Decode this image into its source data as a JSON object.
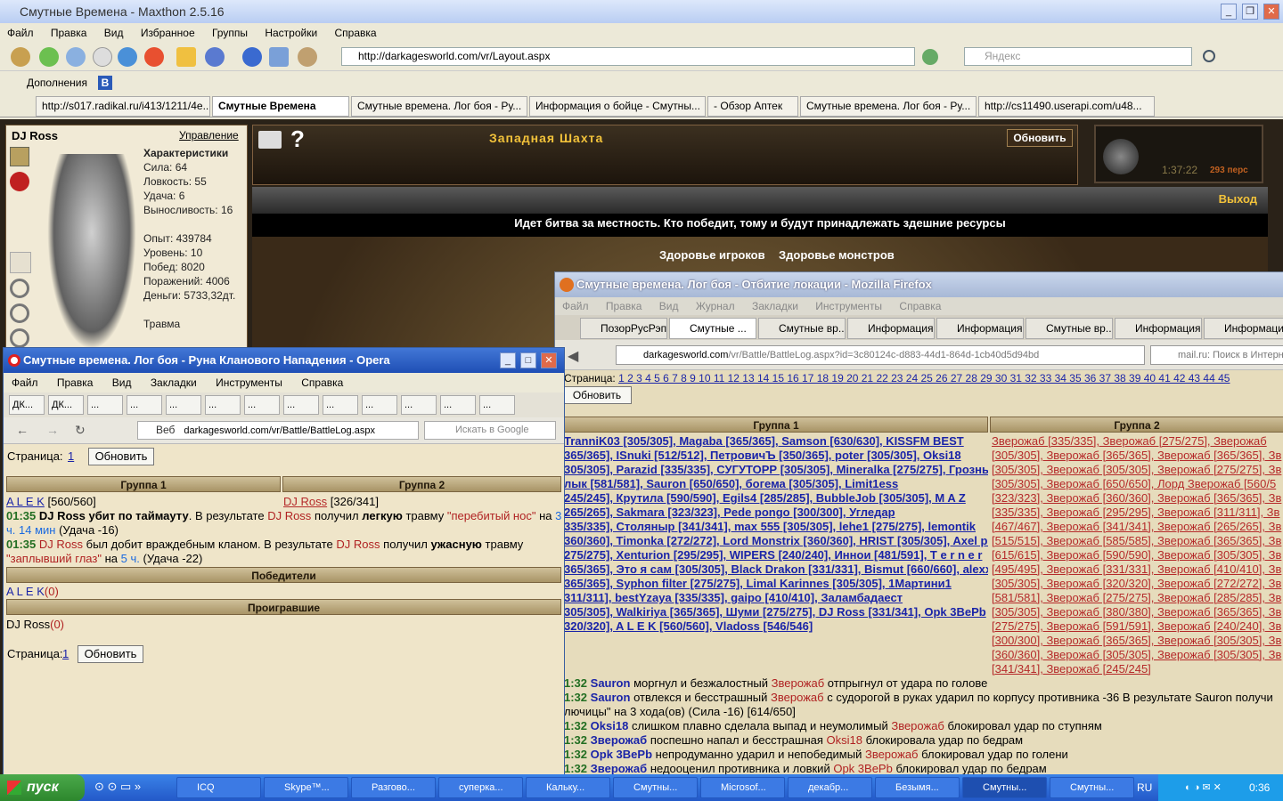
{
  "maxthon": {
    "title": "Смутные Времена - Maxthon 2.5.16",
    "menu": [
      "Файл",
      "Правка",
      "Вид",
      "Избранное",
      "Группы",
      "Настройки",
      "Справка"
    ],
    "url": "http://darkagesworld.com/vr/Layout.aspx",
    "search_placeholder": "Яндекс",
    "addons_label": "Дополнения",
    "tabs": [
      "http://s017.radikal.ru/i413/1211/4e...",
      "Смутные Времена",
      "Смутные времена. Лог боя - Ру...",
      "Информация о бойце - Смутны...",
      "- Обзор Аптек",
      "Смутные времена. Лог боя - Ру...",
      "http://cs11490.userapi.com/u48..."
    ]
  },
  "game": {
    "player": "DJ Ross",
    "manage": "Управление",
    "chars_title": "Характеристики",
    "stats": [
      "Сила: 64",
      "Ловкость: 55",
      "Удача: 6",
      "Выносливость: 16"
    ],
    "exp": [
      "Опыт: 439784",
      "Уровень: 10",
      "Побед: 8020",
      "Поражений: 4006",
      "Деньги: 5733,32дт."
    ],
    "injury": "Травма",
    "location": "Западная Шахта",
    "refresh": "Обновить",
    "exit": "Выход",
    "time": "1:37:22",
    "players_count": "293 перс",
    "battle_text": "Идет битва за местность. Кто победит, тому и будут принадлежать здешние ресурсы",
    "health_players": "Здоровье игроков",
    "health_monsters": "Здоровье монстров"
  },
  "opera": {
    "title": "Смутные времена. Лог боя - Руна Кланового Нападения - Opera",
    "menu": [
      "Файл",
      "Правка",
      "Вид",
      "Закладки",
      "Инструменты",
      "Справка"
    ],
    "tabs": [
      "ДК...",
      "ДК...",
      "...",
      "...",
      "...",
      "...",
      "...",
      "...",
      "...",
      "...",
      "...",
      "...",
      "..."
    ],
    "web": "Веб",
    "url": "darkagesworld.com/vr/Battle/BattleLog.aspx",
    "search": "Искать в Google",
    "page_label": "Страница:",
    "page_num": "1",
    "refresh": "Обновить",
    "group1": "Группа 1",
    "group2": "Группа 2",
    "g1_player": "A L E K",
    "g1_hp": "[560/560]",
    "g2_player": "DJ Ross",
    "g2_hp": "[326/341]",
    "log1_time": "01:35",
    "log1_a": "DJ Ross убит по таймауту",
    "log1_b": ". В результате",
    "log1_name": "DJ Ross",
    "log1_c": "получил",
    "log1_d": "легкую",
    "log1_e": "травму",
    "log1_injury": "\"перебитый нос\"",
    "log1_f": "на",
    "log1_dur": "3 ч. 14 мин",
    "log1_g": "(Удача -16)",
    "log2_time": "01:35",
    "log2_name": "DJ Ross",
    "log2_a": "был добит враждебным кланом. В результате",
    "log2_name2": "DJ Ross",
    "log2_b": "получил",
    "log2_c": "ужасную",
    "log2_d": "травму",
    "log2_injury": "\"заплывший глаз\"",
    "log2_e": "на",
    "log2_dur": "5 ч.",
    "log2_f": "(Удача -22)",
    "winners": "Победители",
    "winner": "A L E K",
    "winner_score": "(0)",
    "losers": "Проигравшие",
    "loser": "DJ Ross",
    "loser_score": "(0)"
  },
  "firefox": {
    "title": "Смутные времена. Лог боя - Отбитие локации - Mozilla Firefox",
    "menu": [
      "Файл",
      "Правка",
      "Вид",
      "Журнал",
      "Закладки",
      "Инструменты",
      "Справка"
    ],
    "tabs": [
      "ПозорРусРэпа",
      "Смутные ...",
      "Смутные вр...",
      "Информация...",
      "Информация...",
      "Смутные вр...",
      "Информация...",
      "Информация..."
    ],
    "url_host": "darkagesworld.com",
    "url_path": "/vr/Battle/BattleLog.aspx?id=3c80124c-d883-44d1-864d-1cb40d5d94bd",
    "search": "mail.ru: Поиск в Интерн",
    "page_label": "Страница:",
    "pages": "1 2 3 4 5 6 7 8 9 10 11 12 13 14 15 16 17 18 19 20 21 22 23 24 25 26 27 28 29 30 31 32 33 34 35 36 37 38 39 40 41 42 43 44 45",
    "refresh": "Обновить",
    "group1": "Группа 1",
    "group2": "Группа 2",
    "g1_rows": [
      "TranniK03 [305/305], Magaba [365/365], Samson [630/630], KISSFM BEST",
      "365/365], ISnuki [512/512], ПетровичЪ [350/365], poter [305/305], Oksi18",
      "305/305], Parazid [335/335], СУГУТОРР [305/305], Mineralka [275/275], Грозный",
      "лык [581/581], Sauron [650/650], богема [305/305], Limit1ess",
      "245/245], Крутила [590/590], Egils4 [285/285], BubbleJob [305/305], M A Z",
      "265/265], Sakmara [323/323], Pede pongo [300/300], Угледар",
      "335/335], Столяныр [341/341], max 555 [305/305], lehe1 [275/275], lemontik",
      "360/360], Timonka [272/272], Lord Monstrix [360/360], HRIST [305/305], Axel pin",
      "275/275], Xenturion [295/295], WIPERS [240/240], Иннои [481/591], T e r n e r",
      "365/365], Это я сам [305/305], Black Drakon [331/331], Bismut [660/660], alexxxl",
      "365/365], Syphon filter [275/275], Limal Karinnes [305/305], 1Мартини1",
      "311/311], bestYzaya [335/335], gaipo [410/410], Заламбадаест",
      "305/305], Walkiriya [365/365], Шуми [275/275], DJ Ross [331/341], Opk 3BePb",
      "320/320], A L E K [560/560], Vladoss [546/546]"
    ],
    "g2_rows": [
      "Зверожаб [335/335], Зверожаб [275/275], Зверожаб",
      "[305/305], Зверожаб [365/365], Зверожаб [365/365], Зв",
      "[305/305], Зверожаб [305/305], Зверожаб [275/275], Зв",
      "[305/305], Зверожаб [650/650], Лорд Зверожаб [560/5",
      "[323/323], Зверожаб [360/360], Зверожаб [365/365], Зв",
      "[335/335], Зверожаб [295/295], Зверожаб [311/311], Зв",
      "[467/467], Зверожаб [341/341], Зверожаб [265/265], Зв",
      "[515/515], Зверожаб [585/585], Зверожаб [365/365], Зв",
      "[615/615], Зверожаб [590/590], Зверожаб [305/305], Зв",
      "[495/495], Зверожаб [331/331], Зверожаб [410/410], Зв",
      "[305/305], Зверожаб [320/320], Зверожаб [272/272], Зв",
      "[581/581], Зверожаб [275/275], Зверожаб [285/285], Зв",
      "[305/305], Зверожаб [380/380], Зверожаб [365/365], Зв",
      "[275/275], Зверожаб [591/591], Зверожаб [240/240], Зв",
      "[300/300], Зверожаб [365/365], Зверожаб [305/305], Зв",
      "[360/360], Зверожаб [305/305], Зверожаб [305/305], Зв",
      "[341/341], Зверожаб [245/245]"
    ],
    "log": [
      {
        "t": "1:32",
        "a": "Sauron",
        "m": "моргнул и безжалостный",
        "b": "Зверожаб",
        "e": "отпрыгнул от удара по голове"
      },
      {
        "t": "1:32",
        "a": "Sauron",
        "m": "отвлекся и бесстрашный",
        "b": "Зверожаб",
        "e": "с судорогой в руках ударил по корпусу противника -36 В результате Sauron получи"
      },
      {
        "t": "",
        "a": "",
        "m": "лючицы\" на 3 хода(ов) (Сила -16) [614/650]",
        "b": "",
        "e": ""
      },
      {
        "t": "1:32",
        "a": "Oksi18",
        "m": "слишком плавно сделала выпад и неумолимый",
        "b": "Зверожаб",
        "e": "блокировал удар по ступням"
      },
      {
        "t": "1:32",
        "a": "Зверожаб",
        "m": "поспешно напал и бесстрашная",
        "b": "Oksi18",
        "e": "блокировала удар по бедрам"
      },
      {
        "t": "1:32",
        "a": "Opk 3BePb",
        "m": "непродуманно ударил и непобедимый",
        "b": "Зверожаб",
        "e": "блокировал удар по голени"
      },
      {
        "t": "1:32",
        "a": "Зверожаб",
        "m": "недооценил противника и ловкий",
        "b": "Opk 3BePb",
        "e": "блокировал удар по бедрам"
      }
    ]
  },
  "taskbar": {
    "start": "пуск",
    "tasks": [
      "ICQ",
      "Skype™...",
      "Разгово...",
      "суперка...",
      "Кальку...",
      "Смутны...",
      "Microsof...",
      "декабр...",
      "Безымя...",
      "Смутны...",
      "Смутны..."
    ],
    "lang": "RU",
    "time": "0:36"
  }
}
